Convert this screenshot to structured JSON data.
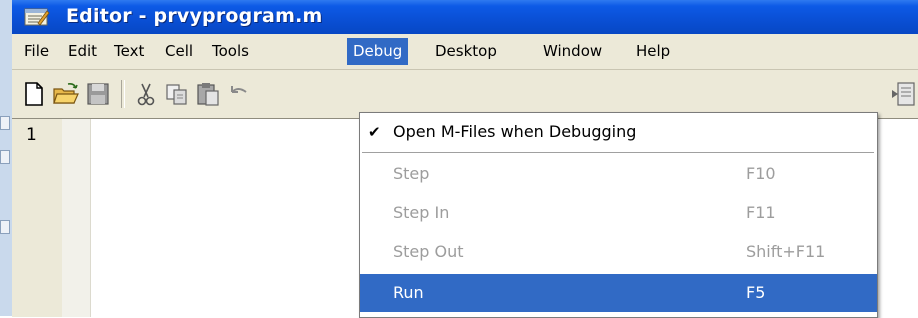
{
  "window": {
    "title": "Editor - prvyprogram.m"
  },
  "menubar": {
    "items": [
      "File",
      "Edit",
      "Text",
      "Cell",
      "Tools",
      "Debug",
      "Desktop",
      "Window",
      "Help"
    ],
    "active": "Debug"
  },
  "toolbar": {
    "buttons": [
      "new-file-icon",
      "open-folder-icon",
      "save-icon",
      "cut-icon",
      "copy-icon",
      "paste-icon",
      "undo-icon"
    ],
    "right_icon": "cell-mode-icon"
  },
  "editor": {
    "line_number": "1"
  },
  "debug_menu": {
    "items": [
      {
        "label": "Open M-Files when Debugging",
        "checked": true,
        "enabled": true,
        "shortcut": ""
      },
      {
        "label": "Step",
        "enabled": false,
        "shortcut": "F10"
      },
      {
        "label": "Step In",
        "enabled": false,
        "shortcut": "F11"
      },
      {
        "label": "Step Out",
        "enabled": false,
        "shortcut": "Shift+F11"
      },
      {
        "label": "Run",
        "enabled": true,
        "highlighted": true,
        "shortcut": "F5"
      }
    ]
  },
  "colors": {
    "titlebar": "#0a50d6",
    "menu_highlight": "#316ac5",
    "chrome": "#ece9d8",
    "disabled_text": "#9d9d9d"
  }
}
